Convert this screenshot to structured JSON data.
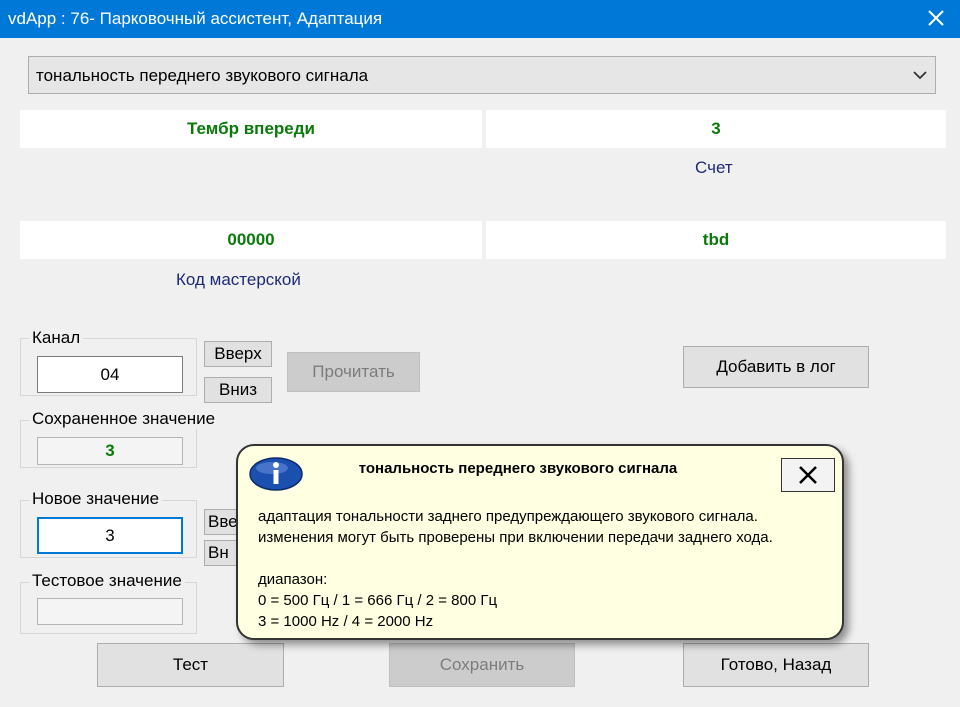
{
  "window": {
    "title": "vdApp : 76- Парковочный ассистент, Адаптация"
  },
  "selector": {
    "value": "тональность переднего звукового сигнала"
  },
  "info": {
    "name_value": "Тембр впереди",
    "count_value": "3",
    "count_label": "Счет",
    "workshop_code_value": "00000",
    "workshop_code_label": "Код мастерской",
    "right_value": "tbd"
  },
  "channel": {
    "label": "Канал",
    "value": "04",
    "up_label": "Вверх",
    "down_label": "Вниз",
    "read_label": "Прочитать"
  },
  "add_log_label": "Добавить в лог",
  "saved": {
    "label": "Сохраненное значение",
    "value": "3"
  },
  "new_value": {
    "label": "Новое значение",
    "value": "3",
    "up_label_partial": "Вве",
    "down_label_partial": "Вн"
  },
  "test_value": {
    "label": "Тестовое значение",
    "value": ""
  },
  "buttons": {
    "test": "Тест",
    "save": "Сохранить",
    "done": "Готово, Назад"
  },
  "popup": {
    "title": "тональность переднего звукового сигнала",
    "line1": "адаптация тональности заднего предупреждающего звукового сигнала.",
    "line2": "изменения могут быть проверены при включении передачи заднего хода.",
    "line3": "диапазон:",
    "line4": "0 = 500 Гц / 1 = 666 Гц / 2 = 800 Гц",
    "line5": "3 = 1000 Hz / 4 = 2000 Hz"
  },
  "colors": {
    "titlebar": "#0078d7",
    "value_green": "#0a7a0a",
    "label_navy": "#1e2a78",
    "popup_bg": "#ffffe1"
  },
  "icons": [
    "close-icon",
    "chevron-down-icon",
    "info-icon",
    "popup-close-icon"
  ]
}
